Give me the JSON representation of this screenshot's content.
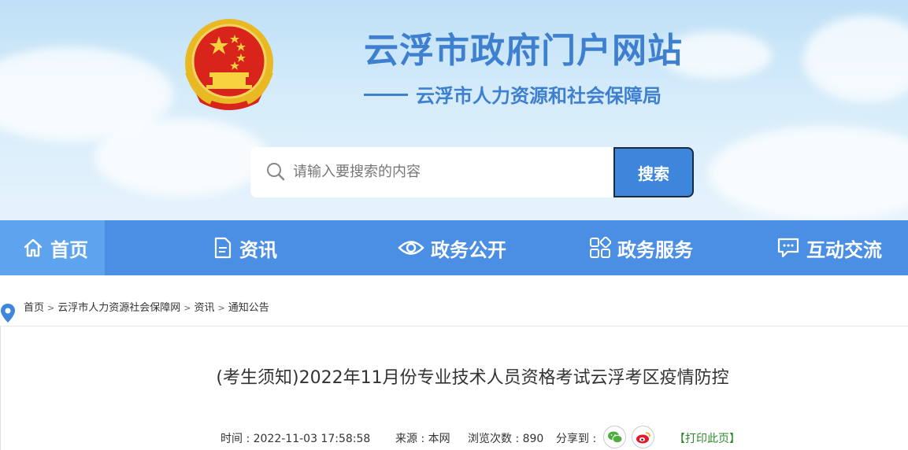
{
  "header": {
    "site_title": "云浮市政府门户网站",
    "site_subtitle": "云浮市人力资源和社会保障局",
    "emblem_icon": "national-emblem-icon"
  },
  "search": {
    "placeholder": "请输入要搜索的内容",
    "button_label": "搜索"
  },
  "nav": {
    "items": [
      {
        "label": "首页",
        "icon": "home-icon"
      },
      {
        "label": "资讯",
        "icon": "document-icon"
      },
      {
        "label": "政务公开",
        "icon": "eye-icon"
      },
      {
        "label": "政务服务",
        "icon": "grid-icon"
      },
      {
        "label": "互动交流",
        "icon": "chat-icon"
      }
    ]
  },
  "breadcrumb": {
    "items": [
      "首页",
      "云浮市人力资源社会保障网",
      "资讯",
      "通知公告"
    ],
    "separator": ">"
  },
  "article": {
    "title": "(考生须知)2022年11月份专业技术人员资格考试云浮考区疫情防控",
    "time": "时间 : 2022-11-03 17:58:58",
    "source": "来源 : 本网",
    "views": "浏览次数 : 890",
    "share_label": "分享到 :",
    "print_label": "【打印此页】"
  },
  "colors": {
    "brand_blue": "#3f7fd0",
    "nav_blue": "#4a8fe3",
    "nav_active": "#5ea3ee",
    "print_green": "#2a8a2a"
  }
}
